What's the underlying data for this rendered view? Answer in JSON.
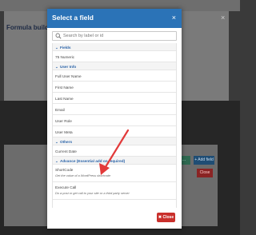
{
  "background": {
    "window_title": "Formula build",
    "window_close": "×",
    "btn_green": "...",
    "btn_blue": "+ Add field",
    "btn_red": "Close"
  },
  "modal": {
    "title": "Select a field",
    "close_glyph": "×",
    "search_placeholder": "Search by label or id",
    "close_button": "Close"
  },
  "rows": [
    {
      "label": "Fields",
      "section": true
    },
    {
      "label": "75 Numeric"
    },
    {
      "label": "User Info",
      "section": true
    },
    {
      "label": "Full User Name"
    },
    {
      "label": "First Name"
    },
    {
      "label": "Last Name"
    },
    {
      "label": "Email"
    },
    {
      "label": "User Role"
    },
    {
      "label": "User Meta"
    },
    {
      "label": "Others",
      "section": true
    },
    {
      "label": "Current Date"
    },
    {
      "label": "Advance (Essential add on required)",
      "section": true
    },
    {
      "label": "ShortCode",
      "desc": "Get the value of a WordPress shortcode"
    },
    {
      "label": "Execute Call",
      "desc": "Do a post or get call to your site or a third party server"
    }
  ],
  "colors": {
    "modal_header": "#2b73b7",
    "section_text": "#2a63a8",
    "close_button": "#c9302c",
    "annotation_arrow": "#e23a3a"
  }
}
